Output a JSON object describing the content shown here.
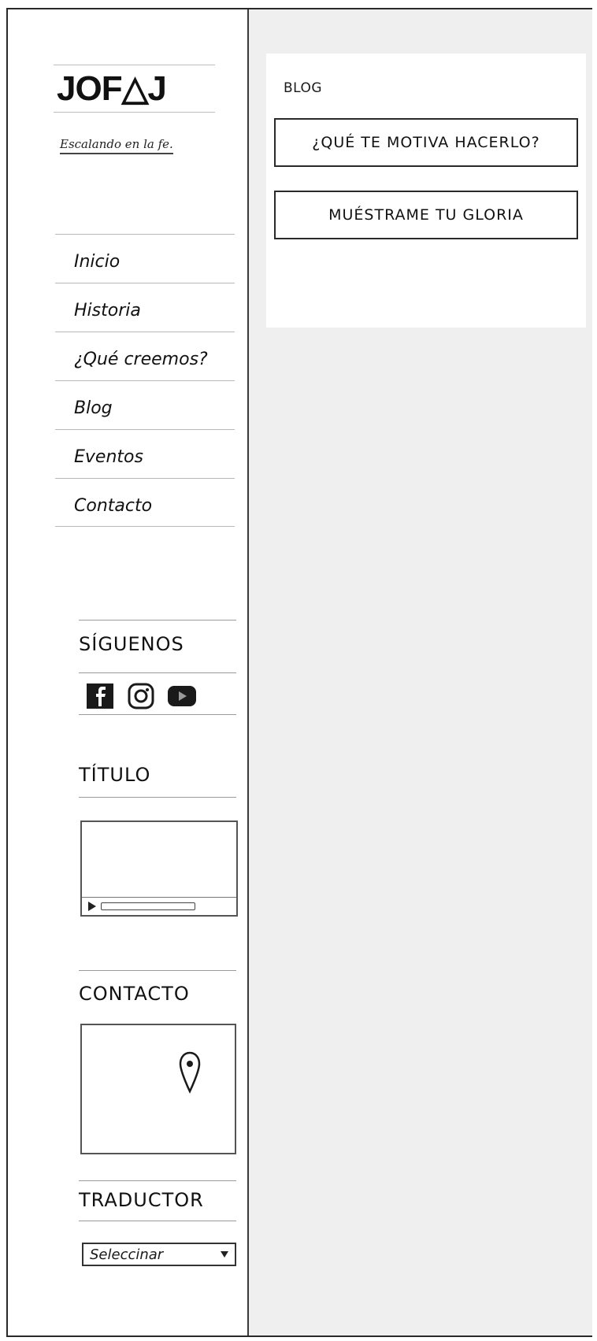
{
  "brand": {
    "logo_text": "JOF△J",
    "tagline": "Escalando en la fe."
  },
  "nav": {
    "items": [
      {
        "label": "Inicio"
      },
      {
        "label": "Historia"
      },
      {
        "label": "¿Qué creemos?"
      },
      {
        "label": "Blog"
      },
      {
        "label": "Eventos"
      },
      {
        "label": "Contacto"
      }
    ]
  },
  "follow": {
    "heading": "SÍGUENOS",
    "icons": [
      "facebook-icon",
      "instagram-icon",
      "youtube-icon"
    ]
  },
  "video": {
    "heading": "TÍTULO"
  },
  "contact": {
    "heading": "CONTACTO"
  },
  "translator": {
    "heading": "TRADUCTOR",
    "selected": "Seleccinar"
  },
  "blog": {
    "title": "BLOG",
    "posts": [
      {
        "label": "¿QUÉ TE MOTIVA HACERLO?"
      },
      {
        "label": "MUÉSTRAME TU GLORIA"
      }
    ]
  },
  "colors": {
    "main_background": "#efefef",
    "card_background": "#ffffff",
    "ink": "#1a1a1a"
  }
}
